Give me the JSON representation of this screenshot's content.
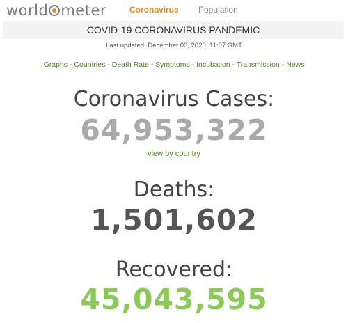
{
  "nav": {
    "logo_prefix": "world",
    "logo_suffix": "meter",
    "coronavirus": "Coronavirus",
    "population": "Population"
  },
  "header": {
    "title": "COVID-19 CORONAVIRUS PANDEMIC",
    "updated": "Last updated: December 03, 2020, 11:07 GMT"
  },
  "links": [
    {
      "label": "Graphs"
    },
    {
      "label": "Countries"
    },
    {
      "label": "Death Rate"
    },
    {
      "label": "Symptoms"
    },
    {
      "label": "Incubation"
    },
    {
      "label": "Transmission"
    },
    {
      "label": "News"
    }
  ],
  "separator": " - ",
  "stats": {
    "cases_label": "Coronavirus Cases:",
    "cases_value": "64,953,322",
    "view_by_country": "view by country",
    "deaths_label": "Deaths:",
    "deaths_value": "1,501,602",
    "recovered_label": "Recovered:",
    "recovered_value": "45,043,595"
  },
  "colors": {
    "accent_orange": "#e38a28",
    "link_green": "#5a7e2a",
    "recovered_green": "#8ac858",
    "cases_gray": "#aaaaaa"
  }
}
